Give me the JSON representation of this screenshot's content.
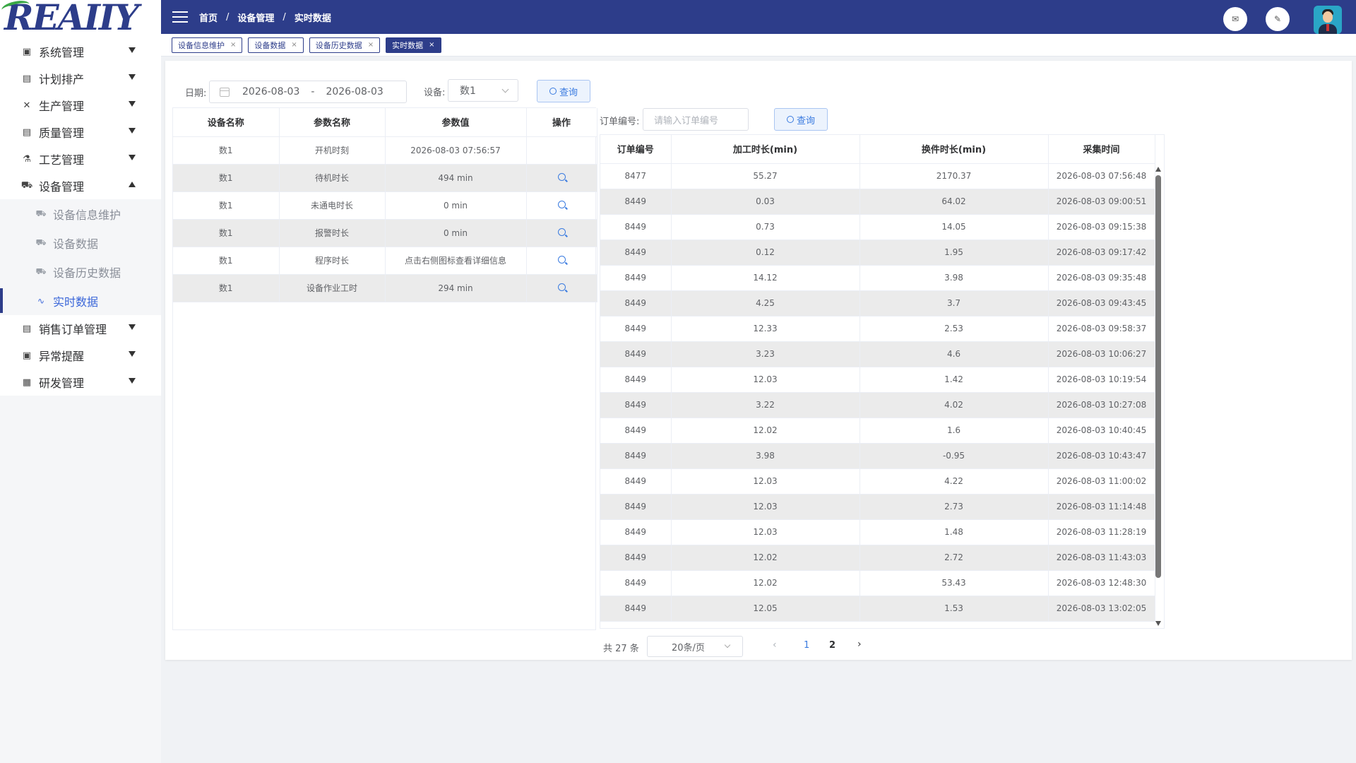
{
  "logo": {
    "text": "REAIIY"
  },
  "sidebar": {
    "items": [
      {
        "label": "系统管理"
      },
      {
        "label": "计划排产"
      },
      {
        "label": "生产管理"
      },
      {
        "label": "质量管理"
      },
      {
        "label": "工艺管理"
      },
      {
        "label": "设备管理"
      }
    ],
    "equipment_sub": [
      {
        "label": "设备信息维护"
      },
      {
        "label": "设备数据"
      },
      {
        "label": "设备历史数据"
      },
      {
        "label": "实时数据"
      }
    ],
    "items_after": [
      {
        "label": "销售订单管理"
      },
      {
        "label": "异常提醒"
      },
      {
        "label": "研发管理"
      }
    ]
  },
  "header": {
    "breadcrumb": [
      "首页",
      "设备管理",
      "实时数据"
    ],
    "separator": "/"
  },
  "tabs": [
    {
      "label": "设备信息维护",
      "close": "×"
    },
    {
      "label": "设备数据",
      "close": "×"
    },
    {
      "label": "设备历史数据",
      "close": "×"
    },
    {
      "label": "实时数据",
      "close": "×"
    }
  ],
  "filters": {
    "date_label": "日期:",
    "date_start": "2026-08-03",
    "date_sep": "-",
    "date_end": "2026-08-03",
    "device_label": "设备:",
    "device_value": "数1",
    "query_label": "查询",
    "order_label": "订单编号:",
    "order_placeholder": "请输入订单编号",
    "order_query_label": "查询"
  },
  "left_table": {
    "headers": [
      "设备名称",
      "参数名称",
      "参数值",
      "操作"
    ],
    "rows": [
      [
        "数1",
        "开机时刻",
        "2026-08-03 07:56:57",
        ""
      ],
      [
        "数1",
        "待机时长",
        "494 min",
        "search"
      ],
      [
        "数1",
        "未通电时长",
        "0 min",
        "search"
      ],
      [
        "数1",
        "报警时长",
        "0 min",
        "search"
      ],
      [
        "数1",
        "程序时长",
        "点击右侧图标查看详细信息",
        "search"
      ],
      [
        "数1",
        "设备作业工时",
        "294 min",
        "search"
      ]
    ]
  },
  "right_table": {
    "headers": [
      "订单编号",
      "加工时长(min)",
      "换件时长(min)",
      "采集时间"
    ],
    "rows": [
      [
        "8477",
        "55.27",
        "2170.37",
        "2026-08-03 07:56:48"
      ],
      [
        "8449",
        "0.03",
        "64.02",
        "2026-08-03 09:00:51"
      ],
      [
        "8449",
        "0.73",
        "14.05",
        "2026-08-03 09:15:38"
      ],
      [
        "8449",
        "0.12",
        "1.95",
        "2026-08-03 09:17:42"
      ],
      [
        "8449",
        "14.12",
        "3.98",
        "2026-08-03 09:35:48"
      ],
      [
        "8449",
        "4.25",
        "3.7",
        "2026-08-03 09:43:45"
      ],
      [
        "8449",
        "12.33",
        "2.53",
        "2026-08-03 09:58:37"
      ],
      [
        "8449",
        "3.23",
        "4.6",
        "2026-08-03 10:06:27"
      ],
      [
        "8449",
        "12.03",
        "1.42",
        "2026-08-03 10:19:54"
      ],
      [
        "8449",
        "3.22",
        "4.02",
        "2026-08-03 10:27:08"
      ],
      [
        "8449",
        "12.02",
        "1.6",
        "2026-08-03 10:40:45"
      ],
      [
        "8449",
        "3.98",
        "-0.95",
        "2026-08-03 10:43:47"
      ],
      [
        "8449",
        "12.03",
        "4.22",
        "2026-08-03 11:00:02"
      ],
      [
        "8449",
        "12.03",
        "2.73",
        "2026-08-03 11:14:48"
      ],
      [
        "8449",
        "12.03",
        "1.48",
        "2026-08-03 11:28:19"
      ],
      [
        "8449",
        "12.02",
        "2.72",
        "2026-08-03 11:43:03"
      ],
      [
        "8449",
        "12.02",
        "53.43",
        "2026-08-03 12:48:30"
      ],
      [
        "8449",
        "12.05",
        "1.53",
        "2026-08-03 13:02:05"
      ]
    ]
  },
  "pagination": {
    "total": "共 27 条",
    "page_size": "20条/页",
    "pages": [
      "1",
      "2"
    ],
    "current": "1",
    "prev": "‹",
    "next": "›"
  },
  "colors": {
    "brand": "#2d3d8a",
    "accent": "#3a7be0",
    "logo_green": "#3aa845"
  }
}
